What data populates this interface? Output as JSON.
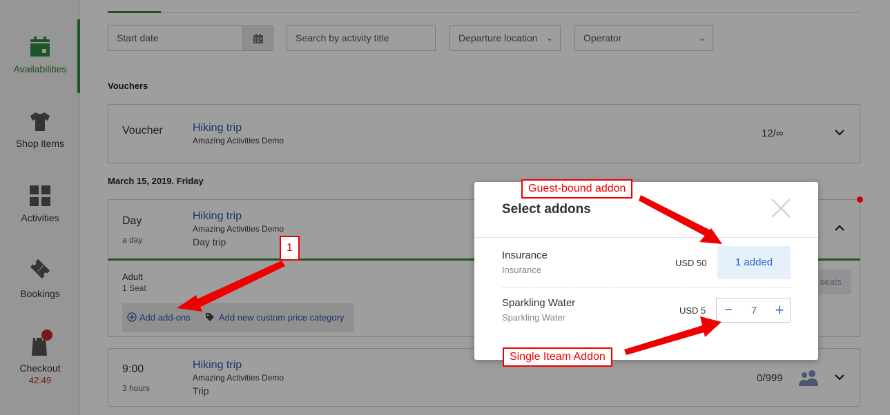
{
  "sidebar": {
    "items": [
      {
        "label": "Availabilities",
        "icon": "calendar-icon"
      },
      {
        "label": "Shop items",
        "icon": "tshirt-icon"
      },
      {
        "label": "Activities",
        "icon": "grid-icon"
      },
      {
        "label": "Bookings",
        "icon": "ticket-icon"
      },
      {
        "label": "Checkout",
        "icon": "shopping-bag-icon",
        "timer": "42:49"
      }
    ],
    "active_color": "#2e8b3a"
  },
  "filters": {
    "start_date": "Start date",
    "search": "Search by activity title",
    "departure": "Departure location",
    "operator": "Operator"
  },
  "vouchers": {
    "section_title": "Vouchers",
    "card": {
      "name": "Voucher",
      "title": "Hiking trip",
      "operator": "Amazing Activities Demo",
      "capacity": "12/∞"
    }
  },
  "date_section": {
    "title": "March 15, 2019. Friday",
    "day_card": {
      "name": "Day",
      "duration": "a day",
      "title": "Hiking trip",
      "operator": "Amazing Activities Demo",
      "type": "Day trip"
    },
    "expanded": {
      "category": "Adult",
      "seats": "1 Seat",
      "seats_button": "seats",
      "add_addons": "Add add-ons",
      "add_custom_price": "Add new custom price category"
    },
    "time_card": {
      "name": "9:00",
      "duration": "3 hours",
      "title": "Hiking trip",
      "operator": "Amazing Activities Demo",
      "type": "Trip",
      "capacity": "0/999"
    }
  },
  "modal": {
    "title": "Select addons",
    "addons": [
      {
        "name": "Insurance",
        "subtitle": "Insurance",
        "price": "USD 50",
        "action": "1 added"
      },
      {
        "name": "Sparkling Water",
        "subtitle": "Sparkling Water",
        "price": "USD 5",
        "quantity": "7"
      }
    ]
  },
  "annotations": {
    "guest_bound": "Guest-bound addon",
    "single_item": "Single Iteam Addon",
    "step_one": "1"
  },
  "colors": {
    "accent_green": "#2e8b3a",
    "link_blue": "#2a55b0",
    "annotation_red": "#ee0000"
  }
}
